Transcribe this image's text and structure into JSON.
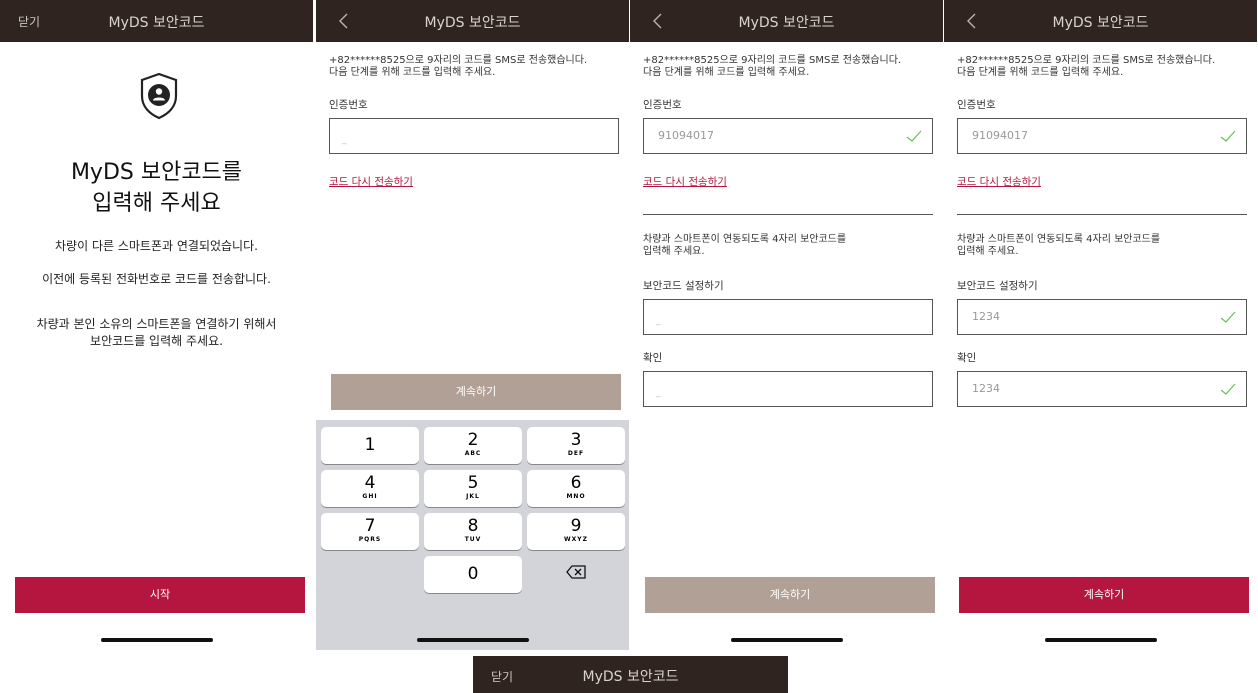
{
  "colors": {
    "header": "#2f2420",
    "accent": "#b5163f",
    "disabled": "#b0a095",
    "check": "#6abf5a"
  },
  "s1": {
    "close": "닫기",
    "title": "MyDS 보안코드",
    "icon": "shield-user-icon",
    "heading": "MyDS 보안코드를\n입력해 주세요",
    "line1": "차량이 다른 스마트폰과 연결되었습니다.",
    "line2": "이전에 등록된 전화번호로 코드를 전송합니다.",
    "line3": "차량과 본인 소유의 스마트폰을 연결하기 위해서\n보안코드를 입력해 주세요.",
    "start": "시작"
  },
  "s2": {
    "title": "MyDS 보안코드",
    "info": "+82******8525으로 9자리의 코드를 SMS로 전송했습니다.\n다음 단계를 위해 코드를 입력해 주세요.",
    "code_label": "인증번호",
    "code_placeholder": "_",
    "resend": "코드 다시 전송하기",
    "continue": "계속하기",
    "keys": [
      {
        "d": "1",
        "l": ""
      },
      {
        "d": "2",
        "l": "ABC"
      },
      {
        "d": "3",
        "l": "DEF"
      },
      {
        "d": "4",
        "l": "GHI"
      },
      {
        "d": "5",
        "l": "JKL"
      },
      {
        "d": "6",
        "l": "MNO"
      },
      {
        "d": "7",
        "l": "PQRS"
      },
      {
        "d": "8",
        "l": "TUV"
      },
      {
        "d": "9",
        "l": "WXYZ"
      },
      {
        "d": "0",
        "l": ""
      }
    ]
  },
  "s3": {
    "title": "MyDS 보안코드",
    "info": "+82******8525으로 9자리의 코드를 SMS로 전송했습니다.\n다음 단계를 위해 코드를 입력해 주세요.",
    "code_label": "인증번호",
    "code_value": "91094017",
    "resend": "코드 다시 전송하기",
    "desc": "차량과 스마트폰이 연동되도록 4자리 보안코드를\n입력해 주세요.",
    "set_label": "보안코드 설정하기",
    "set_placeholder": "_",
    "confirm_label": "확인",
    "confirm_placeholder": "_",
    "continue": "계속하기"
  },
  "s4": {
    "title": "MyDS 보안코드",
    "info": "+82******8525으로 9자리의 코드를 SMS로 전송했습니다.\n다음 단계를 위해 코드를 입력해 주세요.",
    "code_label": "인증번호",
    "code_value": "91094017",
    "resend": "코드 다시 전송하기",
    "desc": "차량과 스마트폰이 연동되도록 4자리 보안코드를\n입력해 주세요.",
    "set_label": "보안코드 설정하기",
    "set_value": "1234",
    "confirm_label": "확인",
    "confirm_value": "1234",
    "continue": "계속하기"
  },
  "bottom": {
    "close": "닫기",
    "title": "MyDS 보안코드"
  }
}
